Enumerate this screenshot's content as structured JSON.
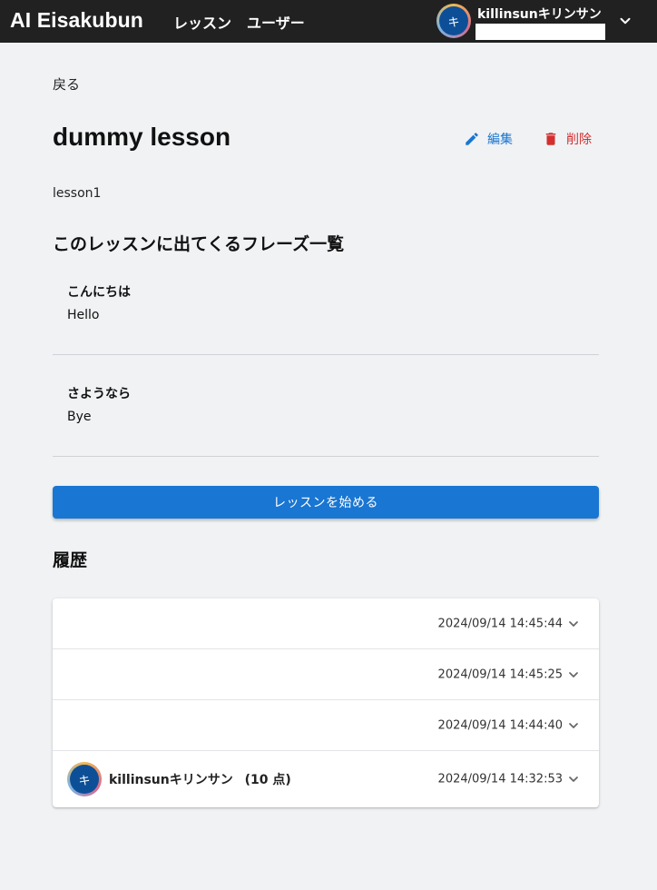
{
  "header": {
    "brand": "AI Eisakubun",
    "nav": [
      "レッスン",
      "ユーザー"
    ],
    "user": {
      "avatar_letter": "キ",
      "name": "killinsunキリンサン"
    }
  },
  "page": {
    "back": "戻る",
    "title": "dummy lesson",
    "edit": "編集",
    "delete": "削除",
    "subtitle": "lesson1",
    "phrases_heading": "このレッスンに出てくるフレーズ一覧",
    "phrases": [
      {
        "jp": "こんにちは",
        "en": "Hello"
      },
      {
        "jp": "さようなら",
        "en": "Bye"
      }
    ],
    "start_button": "レッスンを始める",
    "history_heading": "履歴",
    "history": [
      {
        "timestamp": "2024/09/14 14:45:44"
      },
      {
        "timestamp": "2024/09/14 14:45:25"
      },
      {
        "timestamp": "2024/09/14 14:44:40"
      },
      {
        "timestamp": "2024/09/14 14:32:53",
        "user": "killinsunキリンサン",
        "score": "(10 点)",
        "avatar_letter": "キ"
      }
    ]
  },
  "colors": {
    "primary": "#1976d2",
    "danger": "#d32f2f",
    "appbar": "#212121",
    "background": "#f0f2f4"
  }
}
